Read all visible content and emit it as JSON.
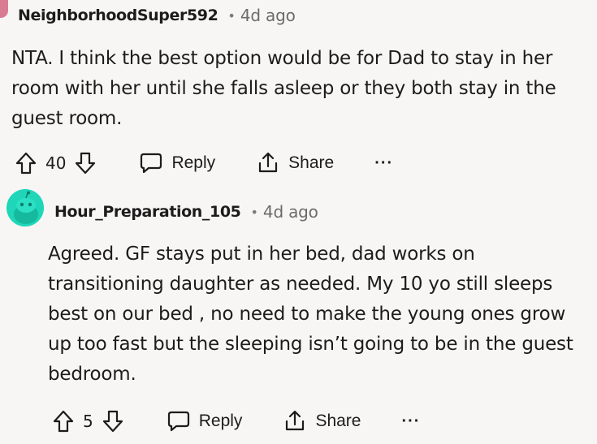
{
  "comments": [
    {
      "username": "NeighborhoodSuper592",
      "separator": "•",
      "timestamp": "4d ago",
      "body": "NTA. I think the best option would be for Dad to stay in her room with her until she falls asleep or they both stay in the guest room.",
      "votes": "40",
      "reply_label": "Reply",
      "share_label": "Share",
      "more_label": "···"
    },
    {
      "username": "Hour_Preparation_105",
      "separator": "•",
      "timestamp": "4d ago",
      "body": "Agreed. GF stays put in her bed, dad works on transitioning daughter as needed. My 10 yo still sleeps best on our bed , no need to make the young ones grow up too fast but the sleeping isn’t going to be in the guest bedroom.",
      "votes": "5",
      "reply_label": "Reply",
      "share_label": "Share",
      "more_label": "···"
    }
  ],
  "colors": {
    "background": "#f8f6f4",
    "avatar_teal": "#1fd6b9",
    "avatar_pink": "#d97b93"
  }
}
